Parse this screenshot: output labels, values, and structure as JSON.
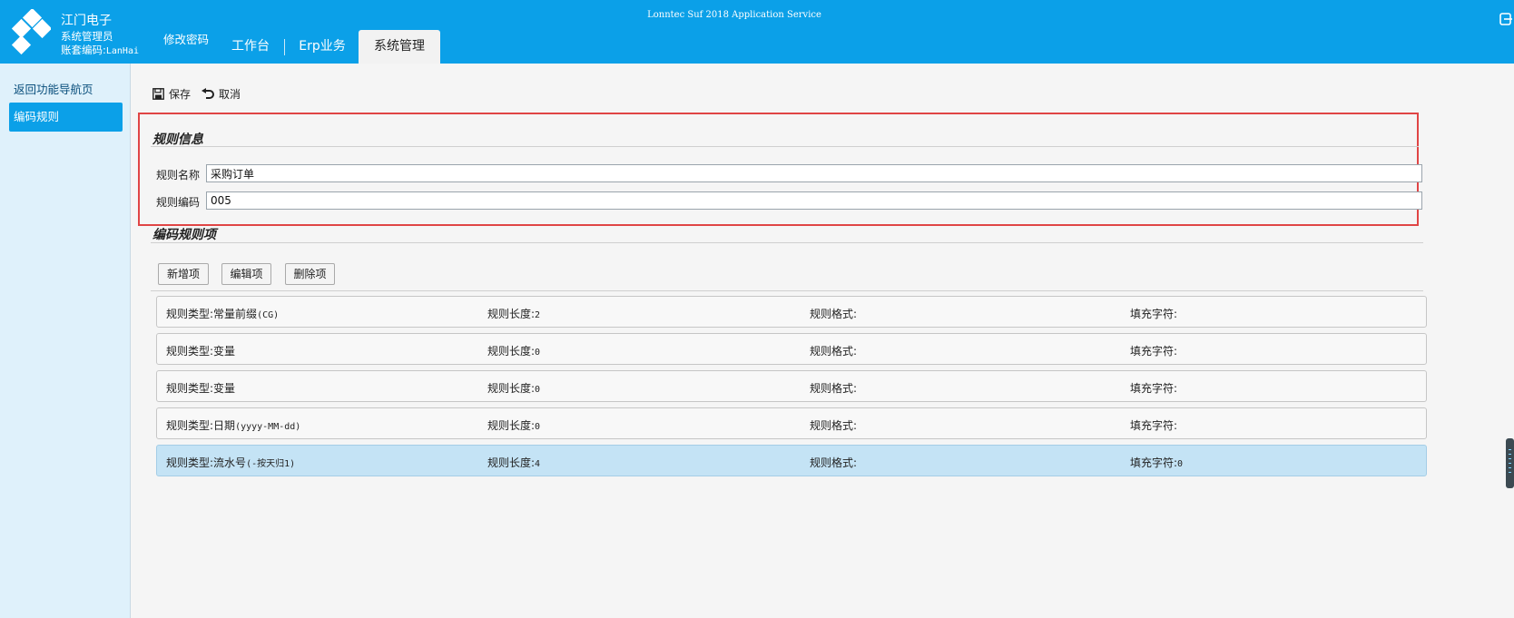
{
  "header": {
    "company": "江门电子",
    "user_role": "系统管理员",
    "account_label": "账套编码:",
    "account_code": "LanHai",
    "change_password": "修改密码",
    "app_title": "Lonntec Suf 2018 Application Service",
    "tabs": [
      {
        "label": "工作台"
      },
      {
        "label": "Erp业务"
      },
      {
        "label": "系统管理",
        "active": true
      }
    ]
  },
  "sidebar": {
    "back_label": "返回功能导航页",
    "active_item": "编码规则"
  },
  "toolbar": {
    "save_label": "保存",
    "cancel_label": "取消"
  },
  "rule_info": {
    "title": "规则信息",
    "name_label": "规则名称",
    "name_value": "采购订单",
    "code_label": "规则编码",
    "code_value": "005"
  },
  "rule_items": {
    "title": "编码规则项",
    "add_label": "新增项",
    "edit_label": "编辑项",
    "delete_label": "删除项",
    "rows": [
      {
        "type_label": "规则类型:",
        "type": "常量前缀",
        "type_detail": "(CG)",
        "length_label": "规则长度:",
        "length": "2",
        "format_label": "规则格式:",
        "format": "",
        "fill_label": "填充字符:",
        "fill": "",
        "selected": false
      },
      {
        "type_label": "规则类型:",
        "type": "变量",
        "type_detail": "",
        "length_label": "规则长度:",
        "length": "0",
        "format_label": "规则格式:",
        "format": "",
        "fill_label": "填充字符:",
        "fill": "",
        "selected": false
      },
      {
        "type_label": "规则类型:",
        "type": "变量",
        "type_detail": "",
        "length_label": "规则长度:",
        "length": "0",
        "format_label": "规则格式:",
        "format": "",
        "fill_label": "填充字符:",
        "fill": "",
        "selected": false
      },
      {
        "type_label": "规则类型:",
        "type": "日期",
        "type_detail": "(yyyy-MM-dd)",
        "length_label": "规则长度:",
        "length": "0",
        "format_label": "规则格式:",
        "format": "",
        "fill_label": "填充字符:",
        "fill": "",
        "selected": false
      },
      {
        "type_label": "规则类型:",
        "type": "流水号",
        "type_detail": "(-按天归1)",
        "length_label": "规则长度:",
        "length": "4",
        "format_label": "规则格式:",
        "format": "",
        "fill_label": "填充字符:",
        "fill": "0",
        "selected": true
      }
    ]
  },
  "colors": {
    "brand": "#0ba0e8",
    "sidebar_bg": "#dff1fb",
    "highlight_border": "#e04545",
    "selected_row": "#c4e3f5"
  }
}
